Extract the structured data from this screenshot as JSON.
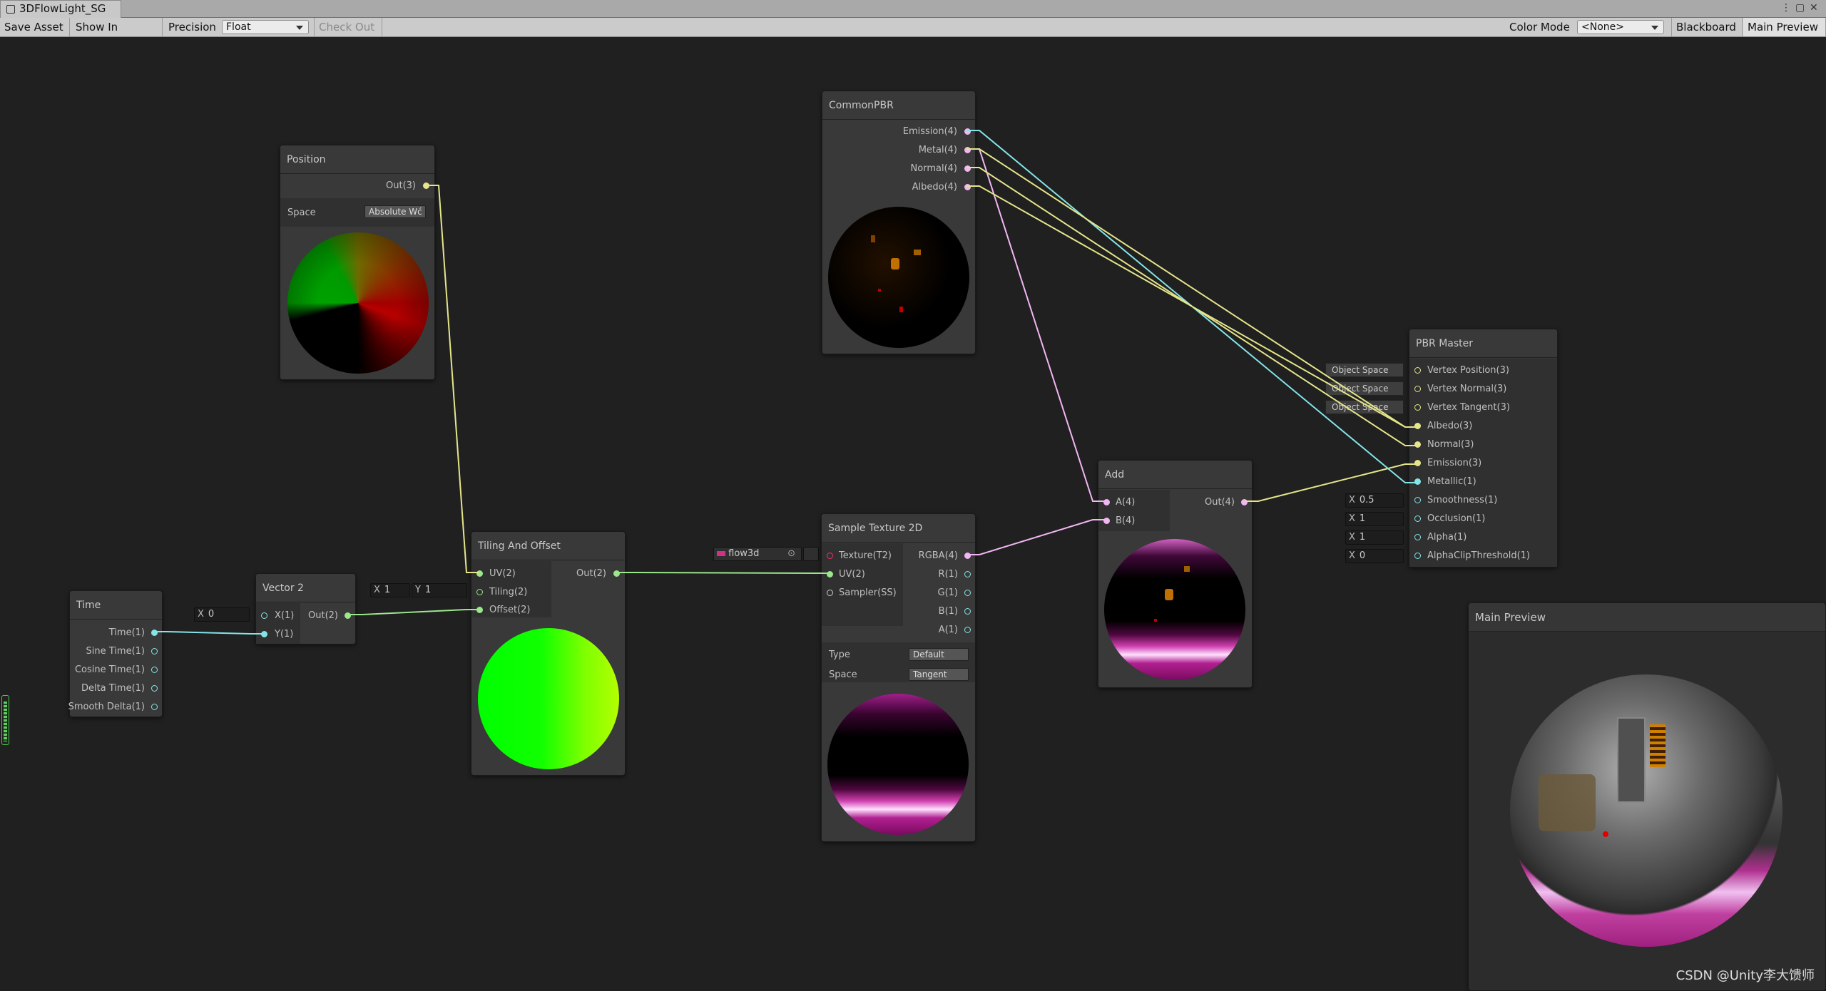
{
  "window": {
    "tab_title": "3DFlowLight_SG"
  },
  "toolbar": {
    "save_asset": "Save Asset",
    "show_in_project": "Show In Project",
    "precision_label": "Precision",
    "precision_value": "Float",
    "check_out": "Check Out",
    "color_mode_label": "Color Mode",
    "color_mode_value": "<None>",
    "blackboard": "Blackboard",
    "main_preview": "Main Preview"
  },
  "nodes": {
    "position": {
      "title": "Position",
      "out": "Out(3)",
      "space_label": "Space",
      "space_value": "Absolute Wć"
    },
    "time": {
      "title": "Time",
      "outputs": [
        "Time(1)",
        "Sine Time(1)",
        "Cosine Time(1)",
        "Delta Time(1)",
        "Smooth Delta(1)"
      ]
    },
    "vector2": {
      "title": "Vector 2",
      "in_x": "X(1)",
      "in_y": "Y(1)",
      "out": "Out(2)",
      "x_label": "X",
      "x_value": "0"
    },
    "tiling": {
      "title": "Tiling And Offset",
      "uv": "UV(2)",
      "tiling": "Tiling(2)",
      "offset": "Offset(2)",
      "out": "Out(2)",
      "tx_label": "X",
      "tx_value": "1",
      "ty_label": "Y",
      "ty_value": "1"
    },
    "commonpbr": {
      "title": "CommonPBR",
      "outputs": [
        "Emission(4)",
        "Metal(4)",
        "Normal(4)",
        "Albedo(4)"
      ]
    },
    "sample": {
      "title": "Sample Texture 2D",
      "inputs": [
        "Texture(T2)",
        "UV(2)",
        "Sampler(SS)"
      ],
      "outputs": [
        "RGBA(4)",
        "R(1)",
        "G(1)",
        "B(1)",
        "A(1)"
      ],
      "type_label": "Type",
      "type_value": "Default",
      "space_label": "Space",
      "space_value": "Tangent",
      "texture_name": "flow3d"
    },
    "add": {
      "title": "Add",
      "in_a": "A(4)",
      "in_b": "B(4)",
      "out": "Out(4)"
    },
    "pbr": {
      "title": "PBR Master",
      "inputs": [
        "Vertex Position(3)",
        "Vertex Normal(3)",
        "Vertex Tangent(3)",
        "Albedo(3)",
        "Normal(3)",
        "Emission(3)",
        "Metallic(1)",
        "Smoothness(1)",
        "Occlusion(1)",
        "Alpha(1)",
        "AlphaClipThreshold(1)"
      ],
      "object_space": "Object Space",
      "default_values": [
        {
          "label": "X",
          "value": "0.5"
        },
        {
          "label": "X",
          "value": "1"
        },
        {
          "label": "X",
          "value": "1"
        },
        {
          "label": "X",
          "value": "0"
        }
      ]
    }
  },
  "main_preview": {
    "title": "Main Preview"
  },
  "watermark": "CSDN @Unity李大馈师",
  "colors": {
    "wire_vec3": "#e5e58a",
    "wire_vec2": "#9be78c",
    "wire_vec4": "#f2b6f2",
    "wire_float": "#84e4e7",
    "magenta": "#c000a0"
  }
}
